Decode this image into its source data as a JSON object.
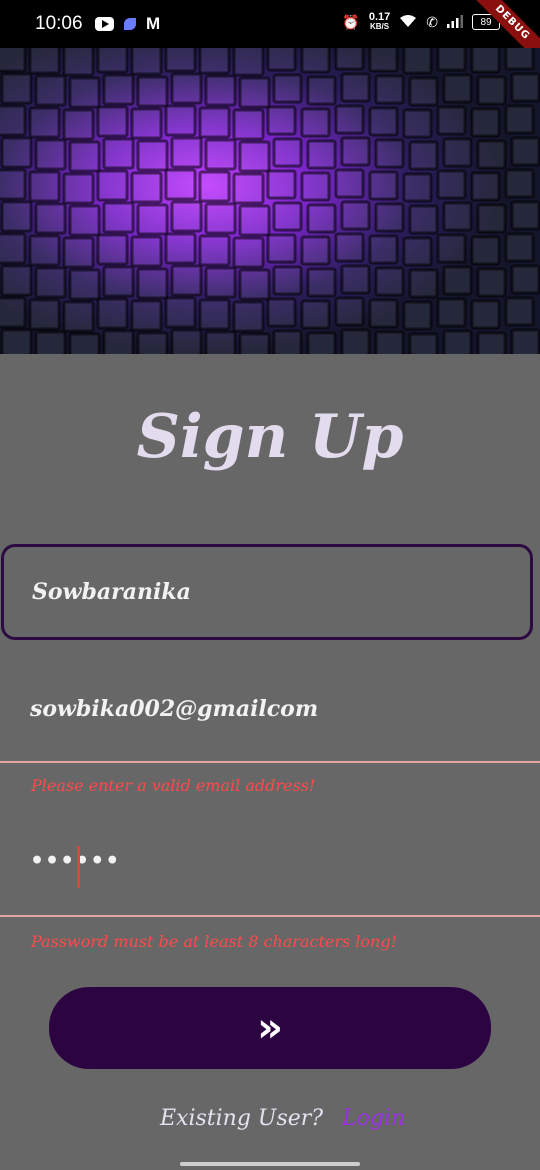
{
  "status_bar": {
    "time": "10:06",
    "speed_value": "0.17",
    "speed_unit": "KB/S",
    "battery": "89",
    "debug_banner": "DEBUG"
  },
  "form": {
    "title": "Sign Up",
    "name_value": "Sowbaranika",
    "email_value": "sowbika002@gmailcom",
    "email_error": "Please enter a valid email address!",
    "password_value": "••••••",
    "password_error": "Password must be at least 8 characters long!",
    "submit_icon": "»"
  },
  "footer": {
    "question": "Existing User?",
    "login_link": "Login"
  },
  "colors": {
    "background": "#676767",
    "accent_dark_purple": "#2c0442",
    "error": "#ff4a4a",
    "link": "#9c2ee6"
  }
}
